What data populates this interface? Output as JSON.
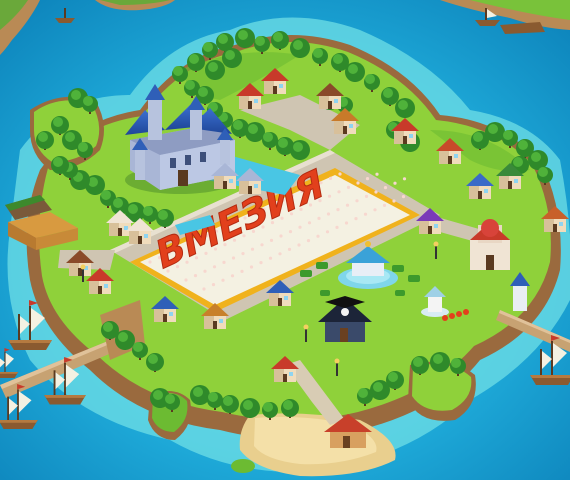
{
  "scene": {
    "flowerbed_word": "ВМЕЗИЯ"
  },
  "colors": {
    "sea_deep": "#1596c8",
    "sea_light": "#3fd0e8",
    "shallow": "#7fe6e6",
    "grass": "#8fd13a",
    "grass_dark": "#5fae2a",
    "cliff": "#b98a55",
    "cliff_dark": "#8a6238",
    "sand": "#f1d9a0",
    "path": "#c9bfae",
    "tree": "#2f8a2a",
    "tree_light": "#4fb23a",
    "castle_wall": "#a9b6d6",
    "castle_roof": "#2f5fb8",
    "flower_red": "#e2401c",
    "flower_white": "#f4f1e2",
    "flower_yellow": "#f0b21c"
  }
}
